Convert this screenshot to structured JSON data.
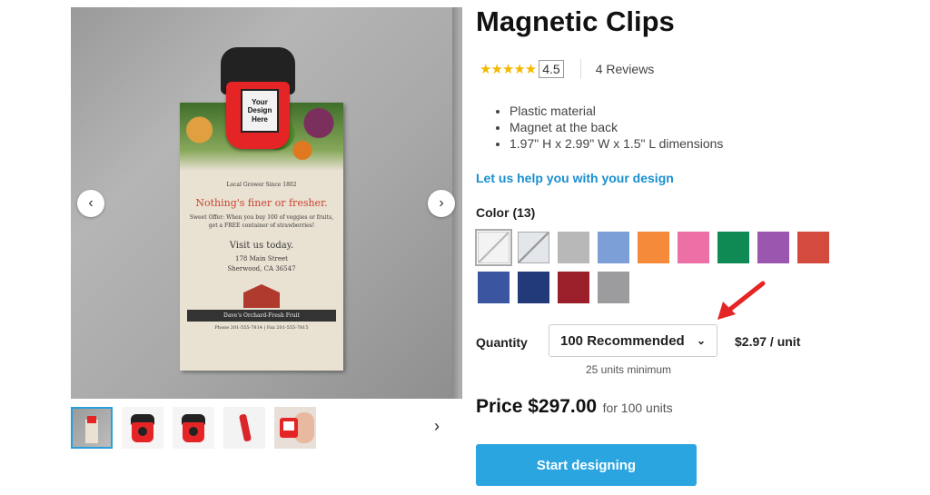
{
  "product": {
    "title": "Magnetic Clips",
    "rating": "4.5",
    "stars": "★★★★★",
    "reviews": "4 Reviews",
    "features": [
      "Plastic material",
      "Magnet at the back",
      "1.97\" H x 2.99\" W x 1.5\" L dimensions"
    ],
    "help_link": "Let us help you with your design"
  },
  "gallery": {
    "clip_label": "Your Design Here",
    "flyer": {
      "tagline": "Local Grower Since 1802",
      "headline": "Nothing's finer or fresher.",
      "offer": "Sweet Offer: When you buy 100 of veggies or fruits, get a FREE container of strawberries!",
      "visit": "Visit us today.",
      "street": "178 Main Street",
      "city": "Sherwood, CA 36547",
      "banner": "Dave's Orchard-Fresh Fruit",
      "phone": "Phone 201-555-7814 | Fax 201-555-7815"
    },
    "prev_icon": "‹",
    "next_icon": "›",
    "thumb_next_icon": "›"
  },
  "color": {
    "label": "Color (13)",
    "swatches": [
      "#f3f3f3",
      "#e3e6ea",
      "#b8b8b8",
      "#7c9fd8",
      "#f48a3a",
      "#ec6fa6",
      "#0f8a55",
      "#9b56b0",
      "#d44a3f",
      "#3b55a0",
      "#233a7a",
      "#9a1f2a",
      "#9c9c9e"
    ]
  },
  "quantity": {
    "label": "Quantity",
    "selected": "100 Recommended",
    "unit_price": "$2.97 / unit",
    "minimum": "25 units minimum"
  },
  "price": {
    "label": "Price $297.00",
    "sub": "for 100 units"
  },
  "cta": {
    "start": "Start designing"
  },
  "colors": {
    "accent": "#2aa5e0",
    "link": "#1a8fcf",
    "star": "#f5b800",
    "annotation_arrow": "#e52425"
  }
}
